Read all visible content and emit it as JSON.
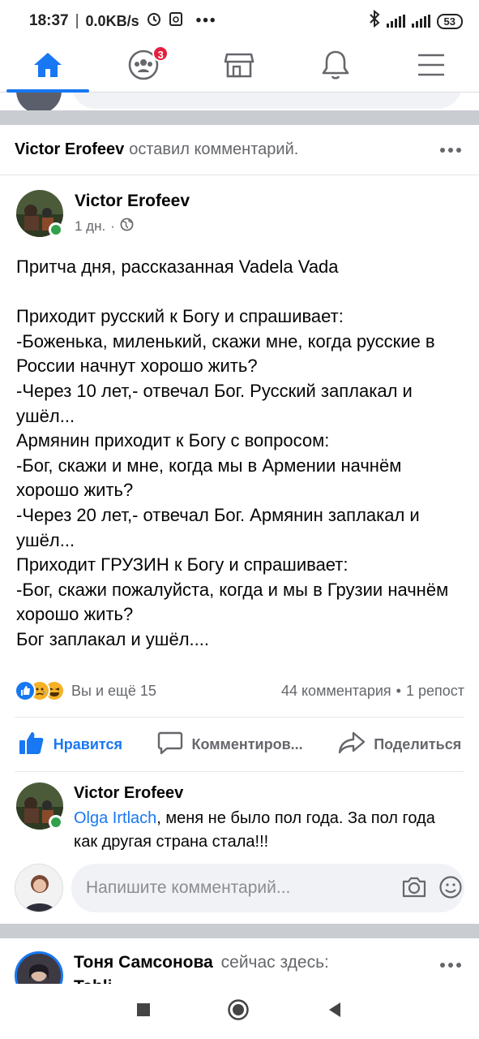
{
  "status_bar": {
    "time": "18:37",
    "network_speed": "0.0KB/s",
    "battery": "53"
  },
  "nav": {
    "items": [
      {
        "name": "home",
        "active": true
      },
      {
        "name": "groups",
        "badge": "3"
      },
      {
        "name": "marketplace"
      },
      {
        "name": "notifications"
      },
      {
        "name": "menu"
      }
    ]
  },
  "activity": {
    "name": "Victor Erofeev",
    "verb": "оставил комментарий."
  },
  "post": {
    "author": "Victor Erofeev",
    "time": "1 дн.",
    "privacy_icon": "globe-icon",
    "text": "Притча дня, рассказанная Vadela Vada\n\nПриходит русский к Богу и спрашивает:\n-Боженька, миленький, скажи мне, когда русские в России начнут хорошо жить?\n-Через 10 лет,- отвечал Бог. Русский заплакал и ушёл...\nАрмянин приходит к Богу с вопросом:\n-Бог, скажи и мне, когда мы в Армении начнём хорошо жить?\n-Через 20 лет,- отвечал Бог. Армянин заплакал и ушёл...\nПриходит ГРУЗИН к Богу и спрашивает:\n-Бог, скажи пожалуйста, когда и мы в Грузии начнём хорошо жить?\nБог заплакал и ушёл....",
    "reactions_text": "Вы и ещё 15",
    "comments_count": "44 комментария",
    "dot": "•",
    "shares_count": "1 репост"
  },
  "actions": {
    "like": "Нравится",
    "comment": "Комментиров...",
    "share": "Поделиться"
  },
  "comment": {
    "author": "Victor Erofeev",
    "mention": "Olga Irtlach",
    "text": ", меня не было пол года. За пол года как другая страна стала!!!"
  },
  "composer": {
    "placeholder": "Напишите комментарий..."
  },
  "next_post": {
    "name": "Тоня Самсонова",
    "verb": "сейчас здесь:",
    "second_line": "Tabli..."
  },
  "colors": {
    "accent": "#1877f2",
    "online": "#31a24c",
    "badge": "#e41e3f",
    "secondary_text": "#65676b"
  }
}
